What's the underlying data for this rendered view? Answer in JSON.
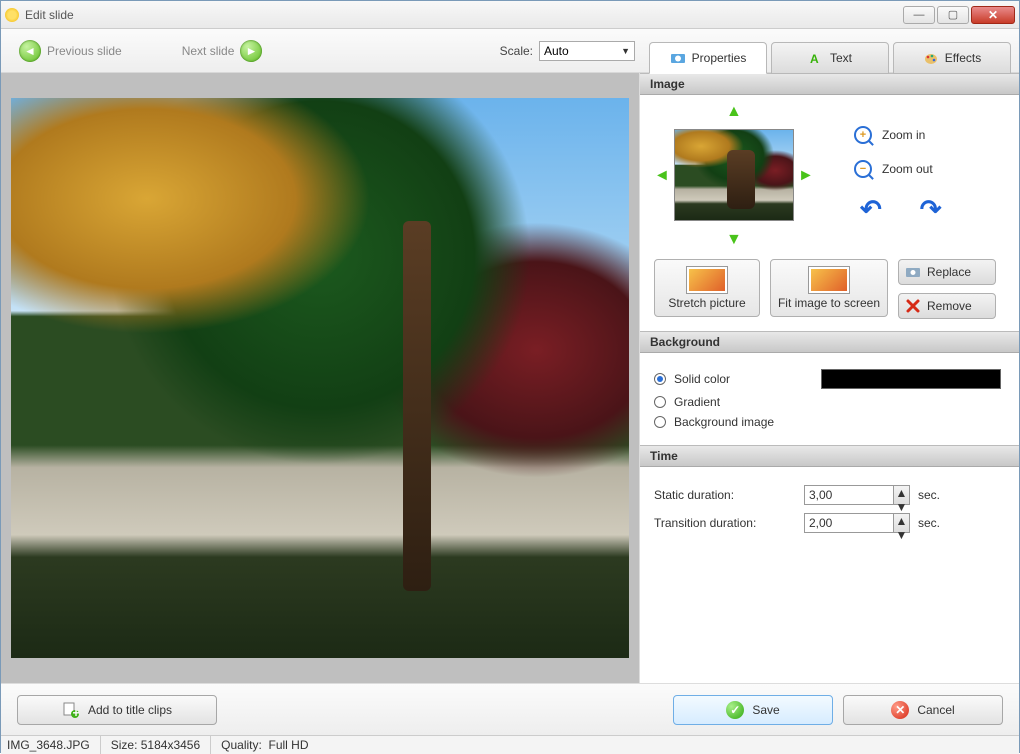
{
  "window": {
    "title": "Edit slide"
  },
  "nav": {
    "prev": "Previous slide",
    "next": "Next slide",
    "scale_label": "Scale:",
    "scale_value": "Auto"
  },
  "tabs": {
    "properties": "Properties",
    "text": "Text",
    "effects": "Effects"
  },
  "image_section": {
    "header": "Image",
    "zoom_in": "Zoom in",
    "zoom_out": "Zoom out",
    "stretch": "Stretch picture",
    "fit": "Fit image to screen",
    "replace": "Replace",
    "remove": "Remove"
  },
  "background_section": {
    "header": "Background",
    "solid": "Solid color",
    "gradient": "Gradient",
    "bgimage": "Background image",
    "color": "#000000"
  },
  "time_section": {
    "header": "Time",
    "static_label": "Static duration:",
    "static_value": "3,00",
    "transition_label": "Transition duration:",
    "transition_value": "2,00",
    "unit": "sec."
  },
  "actions": {
    "add_title": "Add to title clips",
    "save": "Save",
    "cancel": "Cancel"
  },
  "status": {
    "file": "IMG_3648.JPG",
    "size_label": "Size:",
    "size_value": "5184x3456",
    "quality_label": "Quality:",
    "quality_value": "Full HD"
  }
}
